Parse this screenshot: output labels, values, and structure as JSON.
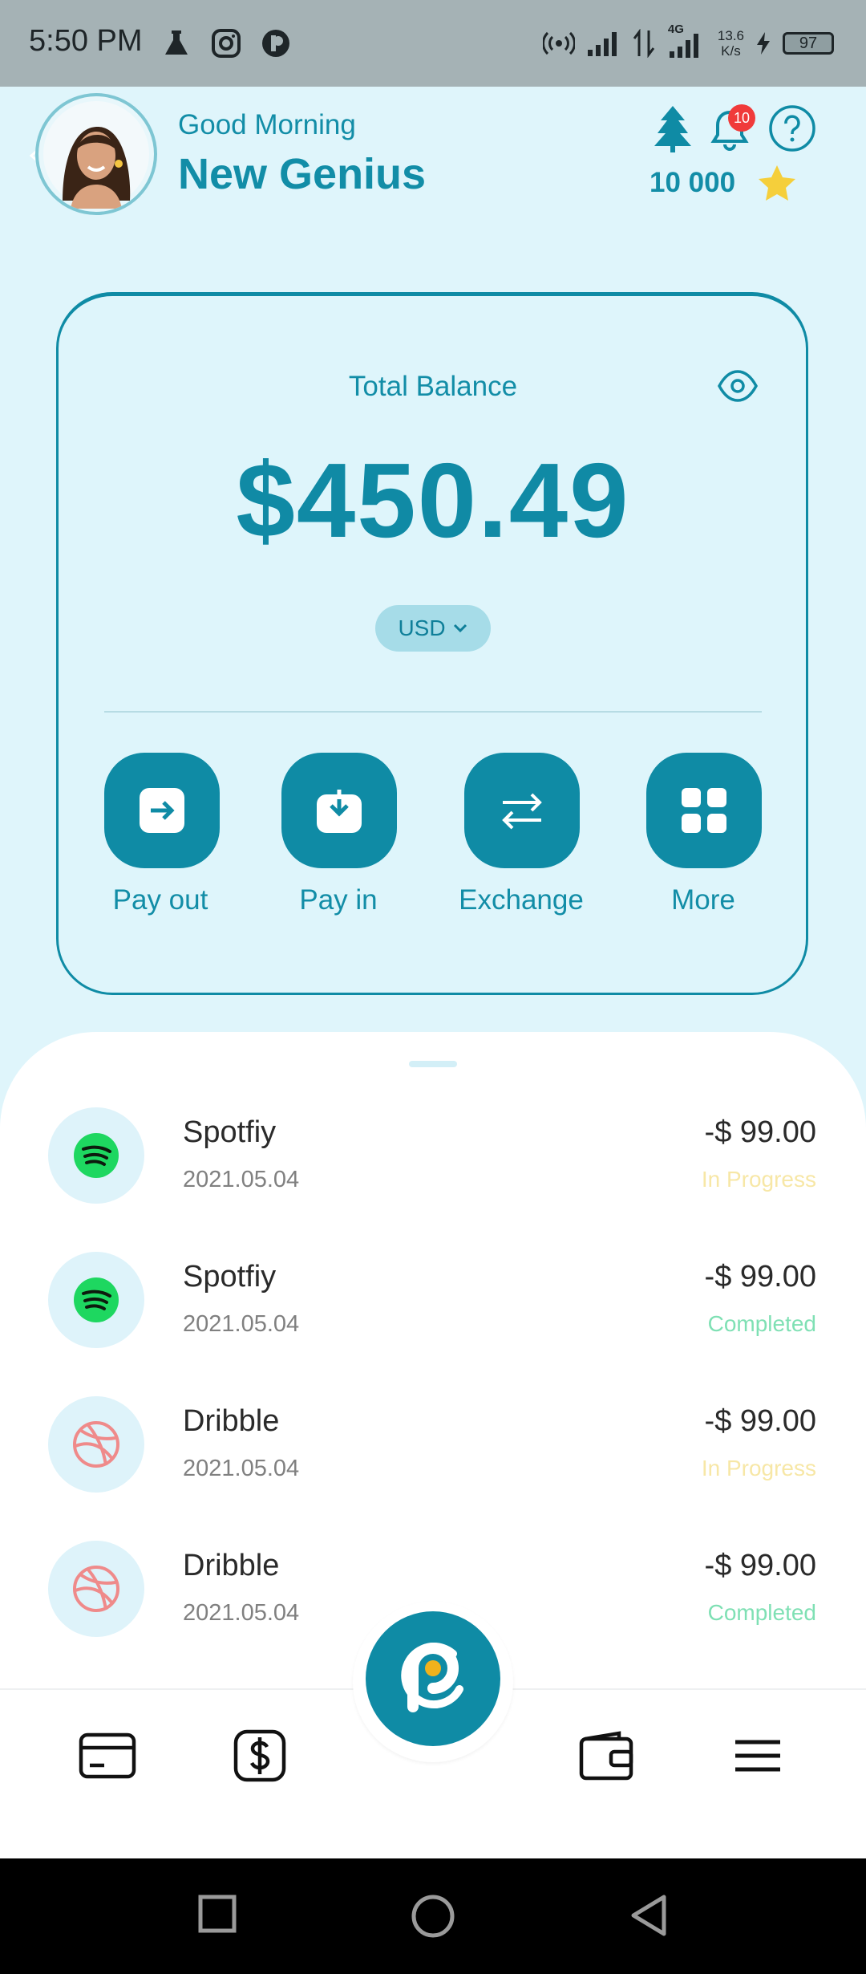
{
  "status_bar": {
    "time": "5:50 PM",
    "network": "4G",
    "speed_value": "13.6",
    "speed_unit": "K/s",
    "battery": "97"
  },
  "header": {
    "greeting": "Good Morning",
    "user_name": "New Genius",
    "notification_count": "10",
    "points": "10 000"
  },
  "balance_card": {
    "label": "Total Balance",
    "amount": "$450.49",
    "currency": "USD",
    "actions": [
      {
        "label": "Pay out",
        "icon": "pay-out-icon"
      },
      {
        "label": "Pay in",
        "icon": "pay-in-icon"
      },
      {
        "label": "Exchange",
        "icon": "exchange-icon"
      },
      {
        "label": "More",
        "icon": "grid-icon"
      }
    ]
  },
  "transactions": [
    {
      "name": "Spotfiy",
      "date": "2021.05.04",
      "amount": "-$ 99.00",
      "status": "In Progress",
      "icon": "spotify-icon"
    },
    {
      "name": "Spotfiy",
      "date": "2021.05.04",
      "amount": "-$ 99.00",
      "status": "Completed",
      "icon": "spotify-icon"
    },
    {
      "name": "Dribble",
      "date": "2021.05.04",
      "amount": "-$ 99.00",
      "status": "In Progress",
      "icon": "dribbble-icon"
    },
    {
      "name": "Dribble",
      "date": "2021.05.04",
      "amount": "-$ 99.00",
      "status": "Completed",
      "icon": "dribbble-icon"
    }
  ],
  "colors": {
    "primary": "#0f8ba5",
    "background": "#dff5fb",
    "in_progress": "#f7e7a6",
    "completed": "#7fe0b4",
    "notification_badge": "#f03a3a",
    "star": "#f5cf3b"
  },
  "bottom_nav": {
    "items": [
      "card-icon",
      "dollar-icon",
      "app-logo-icon",
      "wallet-icon",
      "menu-icon"
    ]
  }
}
